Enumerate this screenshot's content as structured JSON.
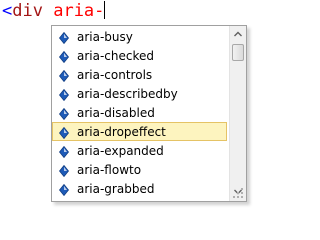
{
  "editor": {
    "open_bracket": "<",
    "tag": "div",
    "attribute": "aria-"
  },
  "completion": {
    "items": [
      {
        "label": "aria-busy",
        "icon": "attribute-icon"
      },
      {
        "label": "aria-checked",
        "icon": "attribute-icon"
      },
      {
        "label": "aria-controls",
        "icon": "attribute-icon"
      },
      {
        "label": "aria-describedby",
        "icon": "attribute-icon"
      },
      {
        "label": "aria-disabled",
        "icon": "attribute-icon"
      },
      {
        "label": "aria-dropeffect",
        "icon": "attribute-icon"
      },
      {
        "label": "aria-expanded",
        "icon": "attribute-icon"
      },
      {
        "label": "aria-flowto",
        "icon": "attribute-icon"
      },
      {
        "label": "aria-grabbed",
        "icon": "attribute-icon"
      }
    ],
    "selected_label": "aria-dropeffect"
  },
  "colors": {
    "bracket": "#0000ff",
    "tag": "#a31515",
    "attribute": "#ff0000",
    "selection_background": "#fdf4bf",
    "selection_border": "#e5c365",
    "icon_blue": "#1e5bb8"
  }
}
